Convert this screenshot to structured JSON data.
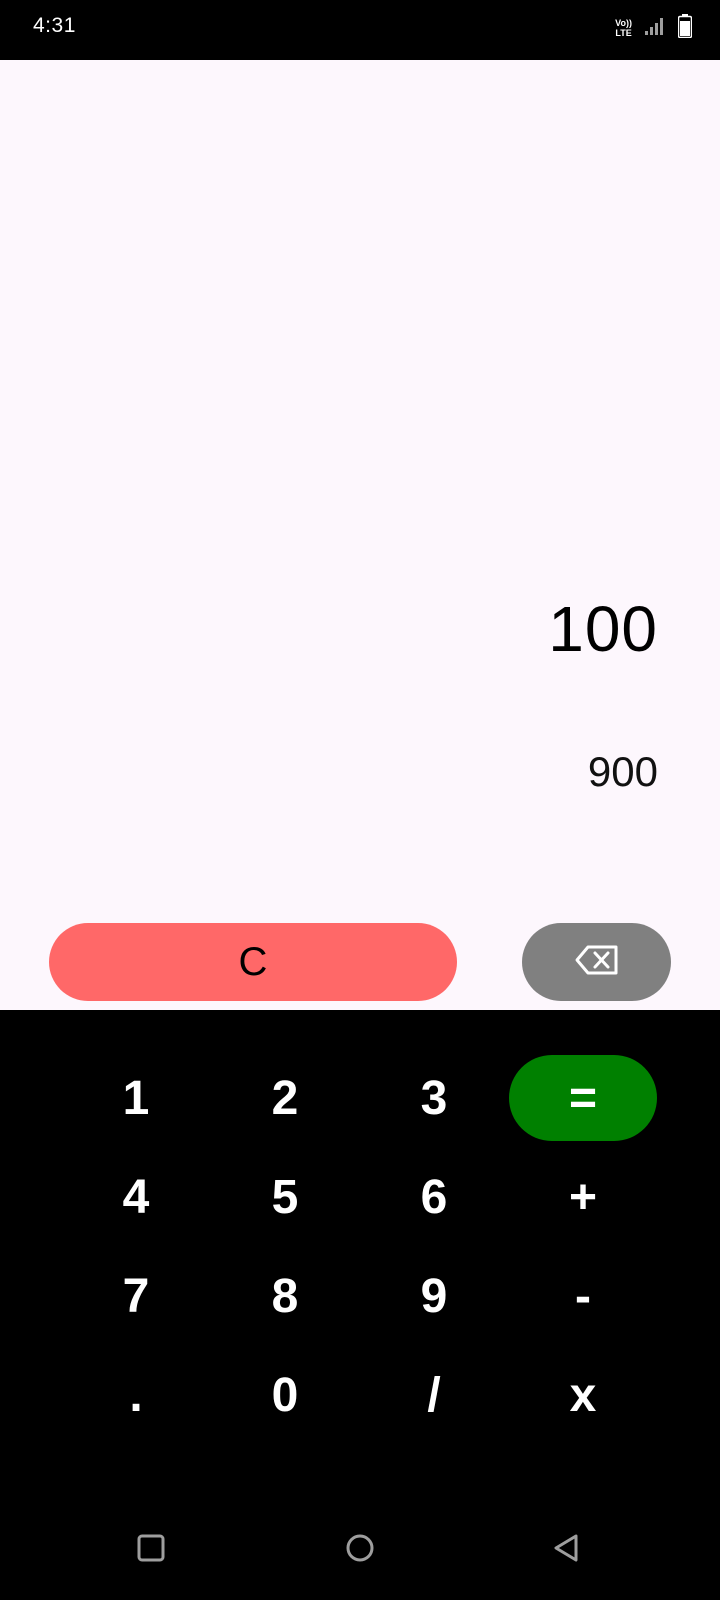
{
  "status_bar": {
    "time": "4:31",
    "volte_top": "Vo))",
    "volte_bottom": "LTE"
  },
  "display": {
    "expression": "100",
    "result": "900"
  },
  "controls": {
    "clear_label": "C",
    "backspace_icon": "backspace-icon"
  },
  "keypad": {
    "rows": [
      [
        "1",
        "2",
        "3",
        "="
      ],
      [
        "4",
        "5",
        "6",
        "+"
      ],
      [
        "7",
        "8",
        "9",
        "-"
      ],
      [
        ".",
        "0",
        "/",
        "x"
      ]
    ]
  },
  "colors": {
    "display_bg": "#fdf7fd",
    "clear_button": "#ff6868",
    "backspace_button": "#808080",
    "equals_button": "#008000",
    "keypad_bg": "#000000"
  },
  "nav_bar": {
    "icons": [
      "recent-apps-icon",
      "home-icon",
      "back-icon"
    ]
  }
}
